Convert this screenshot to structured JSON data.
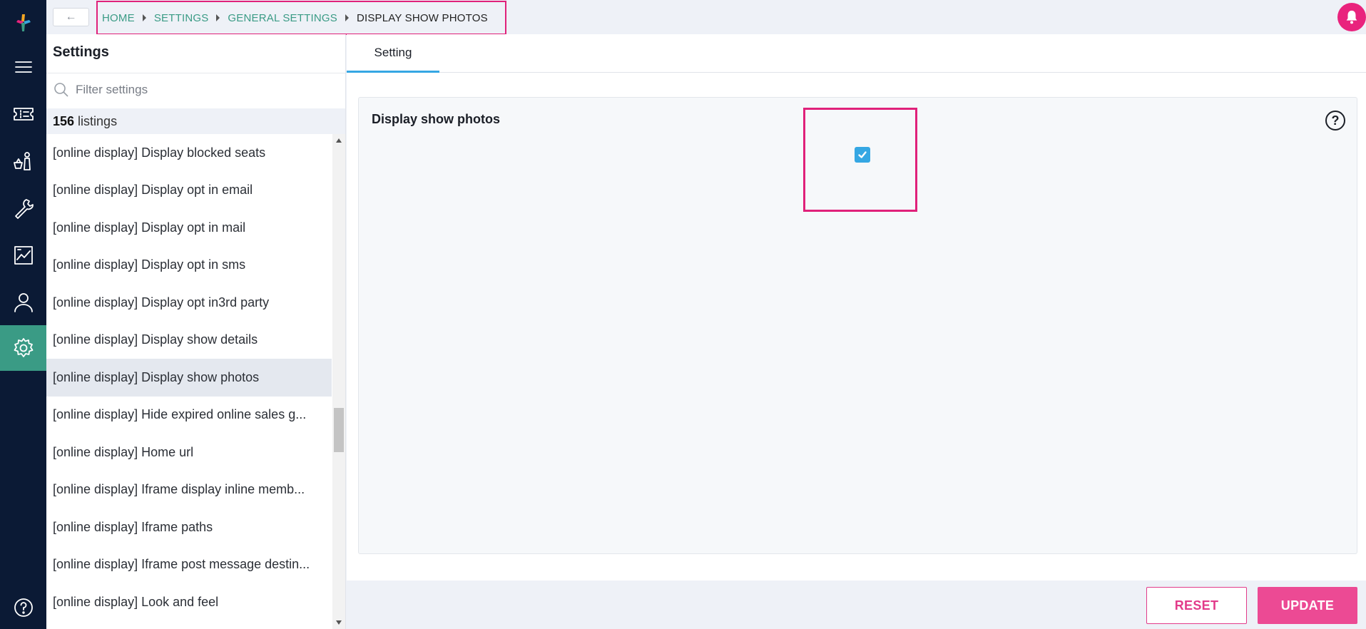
{
  "rail": {
    "items": [
      "logo",
      "menu",
      "tickets",
      "shop",
      "tools",
      "reports",
      "user",
      "settings"
    ],
    "active": "settings",
    "accent": "#3a9b85",
    "background": "#0b1a35"
  },
  "topbar": {
    "back_label": "←",
    "breadcrumb": {
      "home": "HOME",
      "settings": "SETTINGS",
      "general": "GENERAL SETTINGS",
      "current": "DISPLAY SHOW PHOTOS"
    },
    "highlight_color": "#e0217a"
  },
  "panel": {
    "title": "Settings",
    "filter_placeholder": "Filter settings",
    "count_number": "156",
    "count_label": "listings",
    "items": [
      "[online display] Display blocked seats",
      "[online display] Display opt in email",
      "[online display] Display opt in mail",
      "[online display] Display opt in sms",
      "[online display] Display opt in3rd party",
      "[online display] Display show details",
      "[online display] Display show photos",
      "[online display] Hide expired online sales g...",
      "[online display] Home url",
      "[online display] Iframe display inline memb...",
      "[online display] Iframe paths",
      "[online display] Iframe post message destin...",
      "[online display] Look and feel"
    ],
    "selected_index": 6
  },
  "main": {
    "tab_label": "Setting",
    "setting_label": "Display show photos",
    "checked": true,
    "help_label": "?"
  },
  "footer": {
    "reset_label": "RESET",
    "update_label": "UPDATE"
  }
}
